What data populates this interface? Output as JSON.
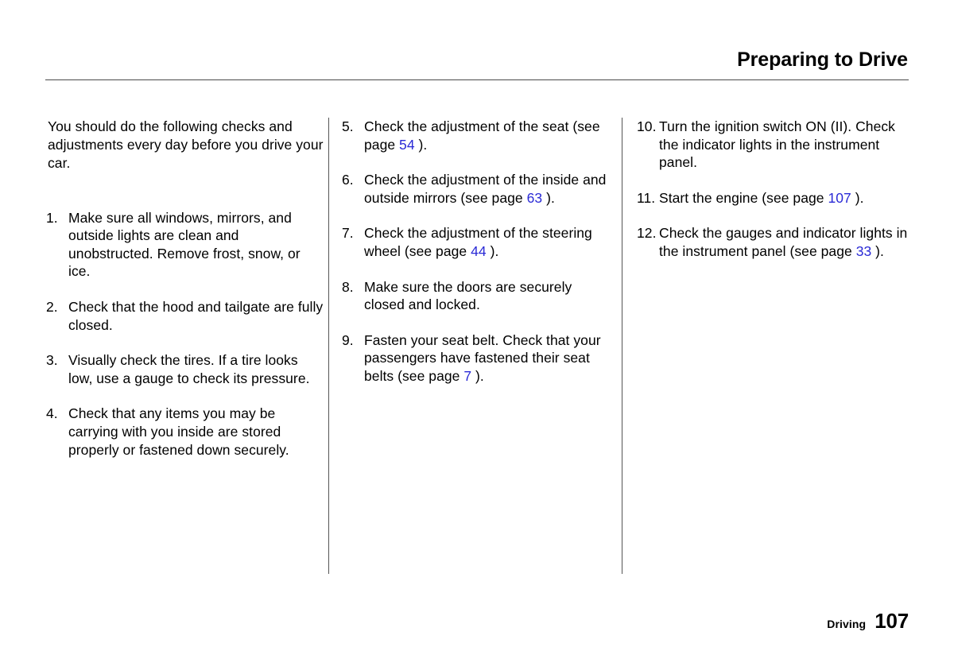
{
  "header": {
    "title": "Preparing to Drive"
  },
  "intro": "You should do the following checks and adjustments every day before you drive your car.",
  "columns": [
    {
      "id": "column-1",
      "items": [
        {
          "number": "1.",
          "text": "Make sure all windows, mirrors, and outside lights are clean and unobstructed. Remove frost, snow, or ice."
        },
        {
          "number": "2.",
          "text": "Check that the hood and tailgate are fully closed."
        },
        {
          "number": "3.",
          "text": "Visually check the tires. If a tire looks low, use a gauge to check its pressure."
        },
        {
          "number": "4.",
          "text": "Check that any items you may be carrying with you inside are stored properly or fastened down securely."
        }
      ]
    },
    {
      "id": "column-2",
      "items": [
        {
          "number": "5.",
          "text_before": "Check the adjustment of the seat (see page ",
          "page_ref": "54",
          "text_after": " )."
        },
        {
          "number": "6.",
          "text_before": "Check the adjustment of the inside and outside mirrors (see page ",
          "page_ref": "63",
          "text_after": " )."
        },
        {
          "number": "7.",
          "text_before": "Check the adjustment of the steering wheel (see page ",
          "page_ref": "44",
          "text_after": " )."
        },
        {
          "number": "8.",
          "text_before": "Make sure the doors are securely closed and locked.",
          "page_ref": "",
          "text_after": ""
        },
        {
          "number": "9.",
          "text_before": "Fasten your seat belt. Check that your passengers have fastened their seat belts (see page ",
          "page_ref": "7",
          "text_after": " )."
        }
      ]
    },
    {
      "id": "column-3",
      "items": [
        {
          "number": "10.",
          "text_before": "Turn the ignition switch ON (II). Check the indicator lights in the instrument panel.",
          "page_ref": "",
          "text_after": ""
        },
        {
          "number": "11.",
          "text_before": "Start the engine (see page ",
          "page_ref": "107",
          "text_after": " )."
        },
        {
          "number": "12.",
          "text_before": "Check the gauges and indicator lights in the instrument panel (see page ",
          "page_ref": "33",
          "text_after": " )."
        }
      ]
    }
  ],
  "footer": {
    "section": "Driving",
    "page_number": "107"
  },
  "colors": {
    "page_reference_blue": "#2a2ad6",
    "rule": "#4a4a4a",
    "text": "#000000"
  }
}
